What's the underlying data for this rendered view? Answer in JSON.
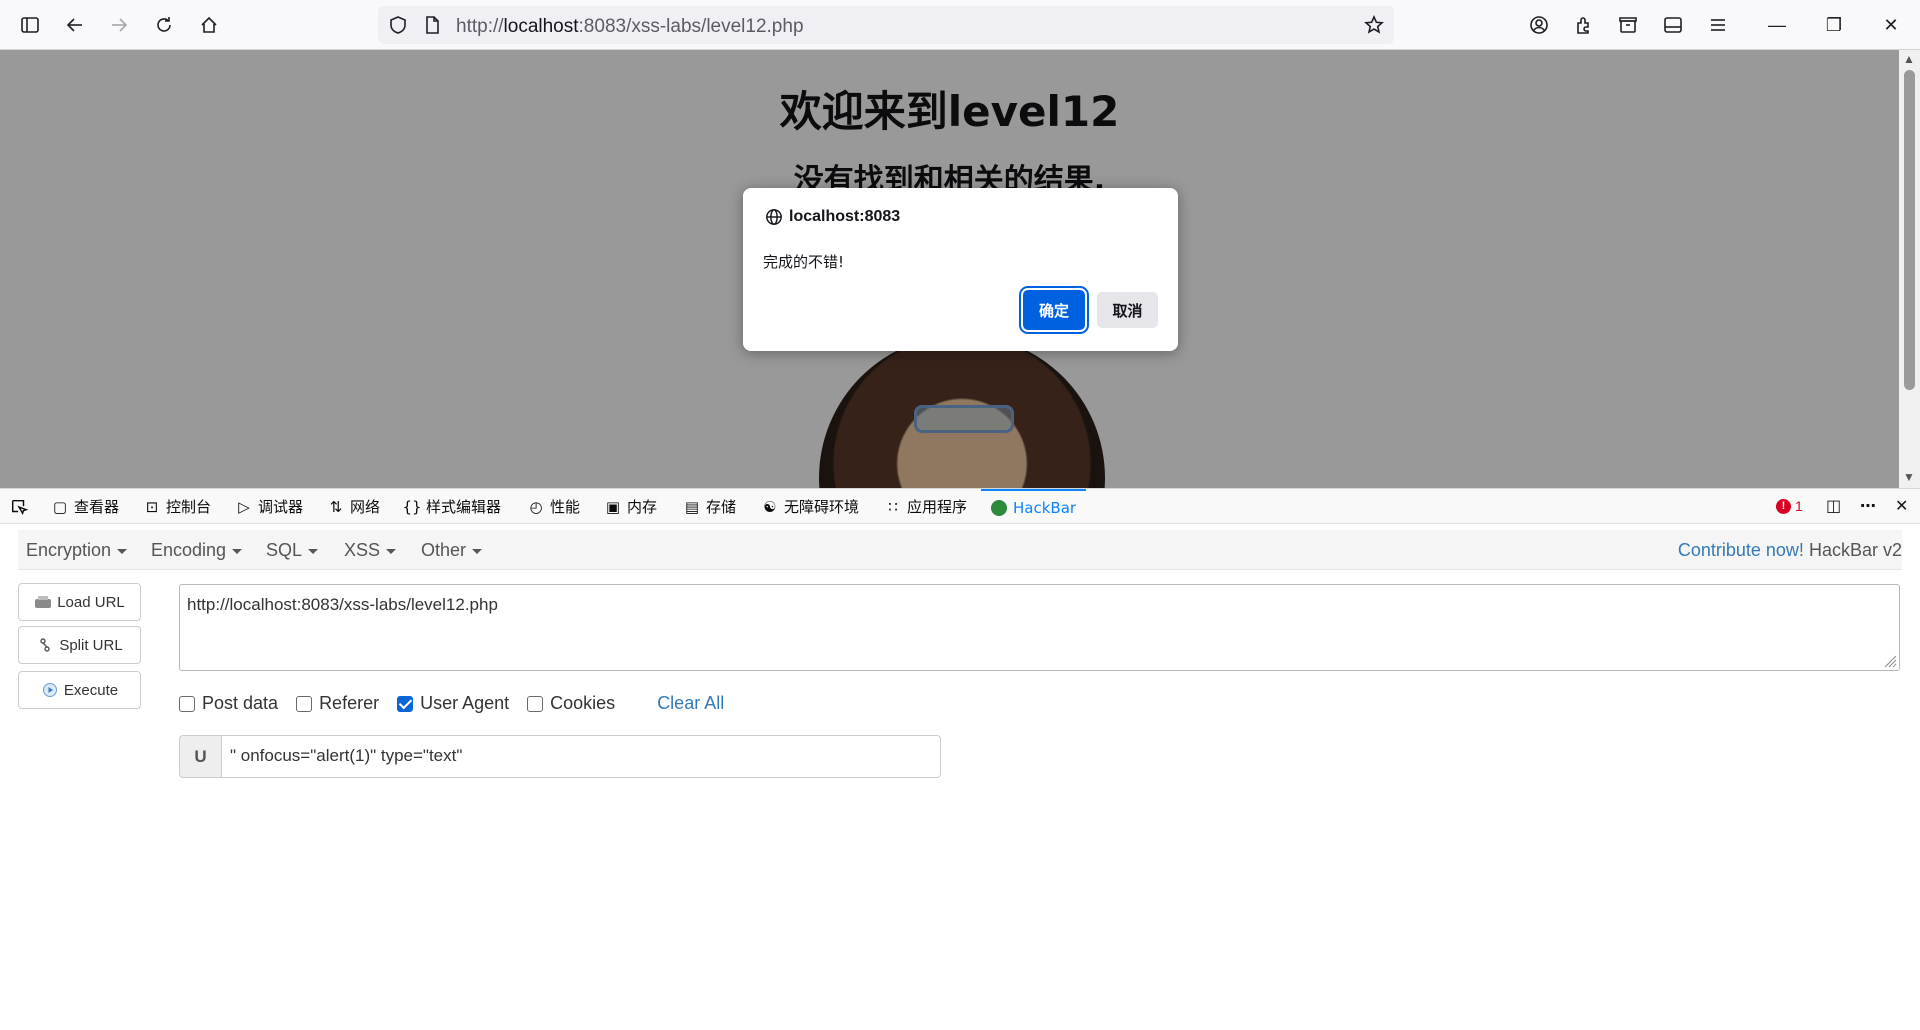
{
  "browser": {
    "url_prefix": "http://",
    "url_host": "localhost",
    "url_rest": ":8083/xss-labs/level12.php"
  },
  "page": {
    "heading": "欢迎来到level12",
    "subheading": "没有找到和相关的结果."
  },
  "dialog": {
    "origin": "localhost:8083",
    "message": "完成的不错!",
    "ok_label": "确定",
    "cancel_label": "取消"
  },
  "devtools": {
    "tabs": [
      {
        "label": "查看器",
        "icon": "inspector-icon"
      },
      {
        "label": "控制台",
        "icon": "console-icon"
      },
      {
        "label": "调试器",
        "icon": "debugger-icon"
      },
      {
        "label": "网络",
        "icon": "network-icon"
      },
      {
        "label": "样式编辑器",
        "icon": "style-editor-icon"
      },
      {
        "label": "性能",
        "icon": "performance-icon"
      },
      {
        "label": "内存",
        "icon": "memory-icon"
      },
      {
        "label": "存储",
        "icon": "storage-icon"
      },
      {
        "label": "无障碍环境",
        "icon": "accessibility-icon"
      },
      {
        "label": "应用程序",
        "icon": "application-icon"
      },
      {
        "label": "HackBar",
        "icon": "hackbar-icon"
      }
    ],
    "error_count": "1"
  },
  "hackbar": {
    "menus": [
      "Encryption",
      "Encoding",
      "SQL",
      "XSS",
      "Other"
    ],
    "contribute_link": "Contribute now!",
    "version": "HackBar v2",
    "buttons": {
      "load_url": "Load URL",
      "split_url": "Split URL",
      "execute": "Execute"
    },
    "url_value": "http://localhost:8083/xss-labs/level12.php",
    "options": [
      {
        "label": "Post data",
        "checked": false
      },
      {
        "label": "Referer",
        "checked": false
      },
      {
        "label": "User Agent",
        "checked": true
      },
      {
        "label": "Cookies",
        "checked": false
      }
    ],
    "clear_all": "Clear All",
    "ua_addon": "U",
    "ua_value": "\" onfocus=\"alert(1)\" type=\"text\""
  },
  "colors": {
    "accent": "#0061e0",
    "devtools_active": "#0a84ff",
    "link": "#337ab7",
    "error": "#d70022"
  }
}
